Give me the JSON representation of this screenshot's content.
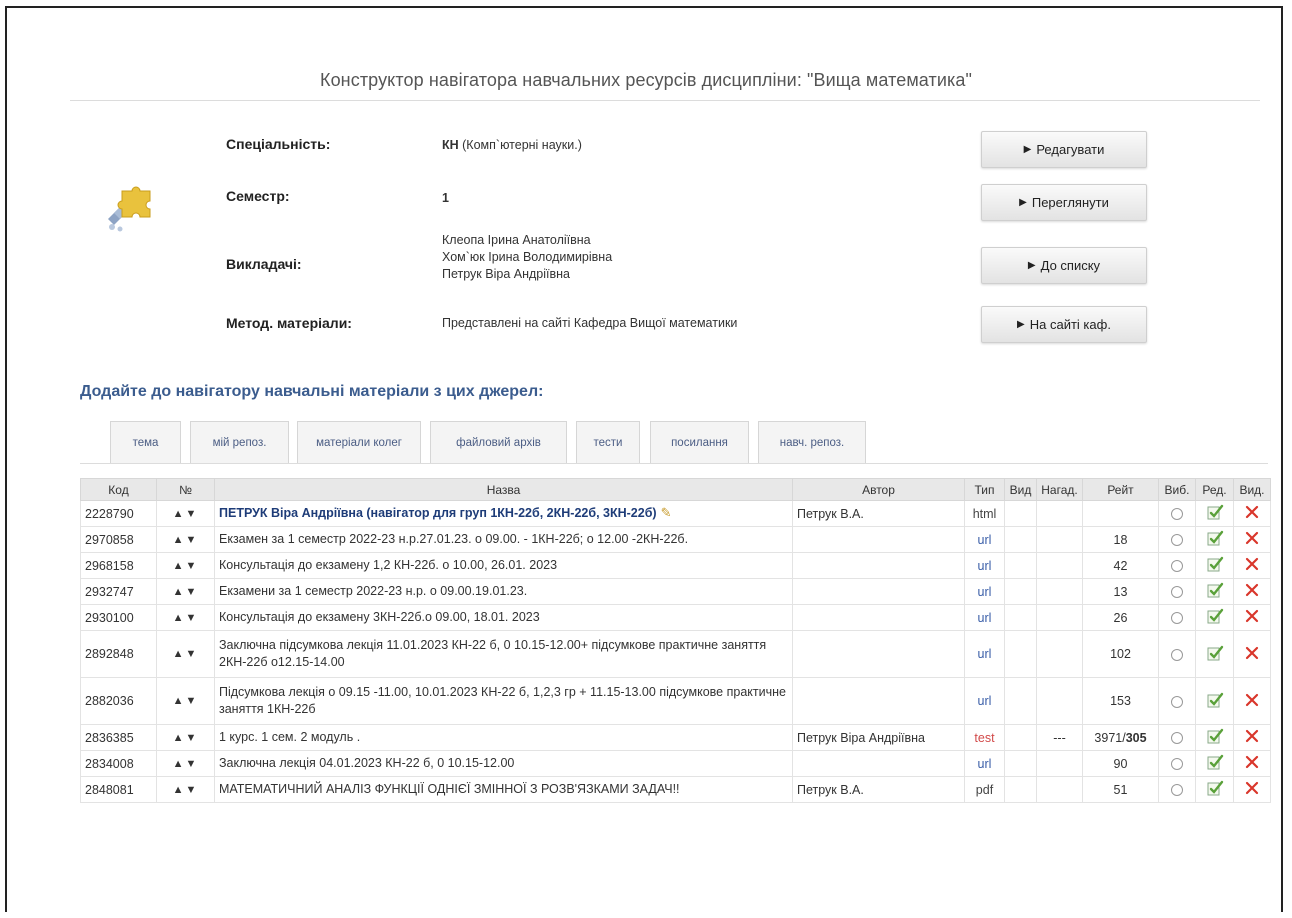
{
  "page": {
    "title": "Конструктор навігатора навчальних ресурсів дисципліни: \"Вища математика\""
  },
  "info": {
    "speciality_label": "Спеціальність:",
    "speciality_code": "КН",
    "speciality_name": " (Комп`ютерні науки.)",
    "semester_label": "Семестр:",
    "semester_value": "1",
    "teachers_label": "Викладачі:",
    "teachers": [
      "Клеопа Ірина Анатоліївна",
      "Хом`юк Ірина Володимирівна",
      "Петрук Віра Андріївна"
    ],
    "materials_label": "Метод. матеріали:",
    "materials_value": "Представлені на сайті Кафедра Вищої математики"
  },
  "buttons": {
    "edit": "Редагувати",
    "view": "Переглянути",
    "to_list": "До списку",
    "dept_site": "На сайті каф."
  },
  "sources": {
    "heading": "Додайте до навігатору навчальні матеріали з цих джерел:",
    "tabs": [
      "тема",
      "мій репоз.",
      "матеріали колег",
      "файловий архів",
      "тести",
      "посилання",
      "навч. репоз."
    ]
  },
  "table": {
    "headers": [
      "Код",
      "№",
      "Назва",
      "Автор",
      "Тип",
      "Вид",
      "Нагад.",
      "Рейт",
      "Виб.",
      "Ред.",
      "Вид."
    ],
    "rows": [
      {
        "code": "2228790",
        "title": "ПЕТРУК Віра Андріївна (навігатор для груп 1КН-22б, 2КН-22б, 3КН-22б)",
        "author": "Петрук В.А.",
        "type": "html",
        "view": "",
        "remind": "",
        "rating": "",
        "rating_bold": ""
      },
      {
        "code": "2970858",
        "title": "Екзамен за 1 семестр 2022-23 н.р.27.01.23. о 09.00. - 1КН-22б; о 12.00 -2КН-22б.",
        "author": "",
        "type": "url",
        "view": "",
        "remind": "",
        "rating": "18",
        "rating_bold": ""
      },
      {
        "code": "2968158",
        "title": "Консультація до екзамену 1,2 КН-22б. о 10.00, 26.01. 2023",
        "author": "",
        "type": "url",
        "view": "",
        "remind": "",
        "rating": "42",
        "rating_bold": ""
      },
      {
        "code": "2932747",
        "title": "Екзамени за 1 семестр 2022-23 н.р. о 09.00.19.01.23.",
        "author": "",
        "type": "url",
        "view": "",
        "remind": "",
        "rating": "13",
        "rating_bold": ""
      },
      {
        "code": "2930100",
        "title": "Консультація до екзамену 3КН-22б.о 09.00, 18.01. 2023",
        "author": "",
        "type": "url",
        "view": "",
        "remind": "",
        "rating": "26",
        "rating_bold": ""
      },
      {
        "code": "2892848",
        "title": "Заключна підсумкова лекція 11.01.2023 КН-22 б, 0 10.15-12.00+ підсумкове практичне заняття 2КН-22б о12.15-14.00",
        "author": "",
        "type": "url",
        "view": "",
        "remind": "",
        "rating": "102",
        "rating_bold": ""
      },
      {
        "code": "2882036",
        "title": "Підсумкова лекція о 09.15 -11.00, 10.01.2023 КН-22 б, 1,2,3 гр + 11.15-13.00 підсумкове практичне заняття 1КН-22б",
        "author": "",
        "type": "url",
        "view": "",
        "remind": "",
        "rating": "153",
        "rating_bold": ""
      },
      {
        "code": "2836385",
        "title": "1 курс. 1 сем. 2 модуль .",
        "author": "Петрук Віра Андріївна",
        "type": "test",
        "view": "",
        "remind": "---",
        "rating": "3971/",
        "rating_bold": "305"
      },
      {
        "code": "2834008",
        "title": "Заключна лекція 04.01.2023 КН-22 б, 0 10.15-12.00",
        "author": "",
        "type": "url",
        "view": "",
        "remind": "",
        "rating": "90",
        "rating_bold": ""
      },
      {
        "code": "2848081",
        "title": "МАТЕМАТИЧНИЙ АНАЛІЗ ФУНКЦІЇ ОДНІЄЇ ЗМІННОЇ З РОЗВ'ЯЗКАМИ ЗАДАЧ!!",
        "author": "Петрук В.А.",
        "type": "pdf",
        "view": "",
        "remind": "",
        "rating": "51",
        "rating_bold": ""
      }
    ]
  },
  "icons": {
    "up": "up-arrow-icon",
    "down": "down-arrow-icon",
    "edit": "edit-checkbox-icon",
    "delete": "delete-icon",
    "pencil": "pencil-icon",
    "logo": "puzzle-logo-icon"
  },
  "colors": {
    "link": "#2e4f86",
    "heading": "#3b5c8e",
    "test_type": "#d24b4b",
    "delete": "#d9362b",
    "edit": "#5aa13a"
  }
}
